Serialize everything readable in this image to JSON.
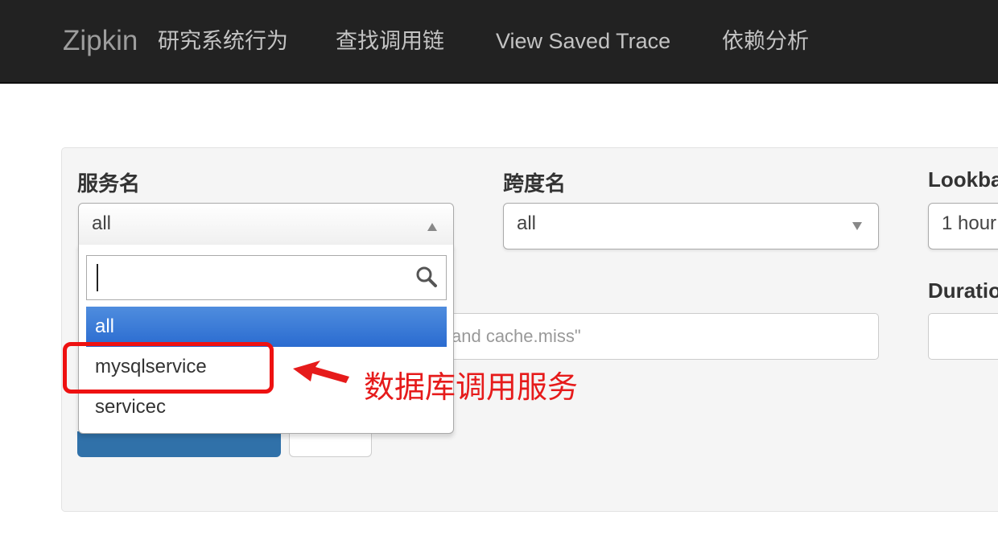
{
  "nav": {
    "brand": "Zipkin",
    "items": [
      "研究系统行为",
      "查找调用链",
      "View Saved Trace",
      "依赖分析"
    ]
  },
  "form": {
    "service_label": "服务名",
    "service_value": "all",
    "span_label": "跨度名",
    "span_value": "all",
    "lookback_label": "Lookba",
    "lookback_value": "1 hour",
    "duration_label": "Duratio",
    "annotation_query_partial": "and cache.miss\""
  },
  "dropdown": {
    "search_value": "",
    "options": [
      "all",
      "mysqlservice",
      "servicec"
    ],
    "highlighted_index": 0
  },
  "annotation": {
    "text": "数据库调用服务"
  },
  "colors": {
    "navbar_bg": "#222222",
    "highlight_blue": "#2a6bd0",
    "annotation_red": "#e61b1b",
    "primary_button": "#3071a9"
  }
}
